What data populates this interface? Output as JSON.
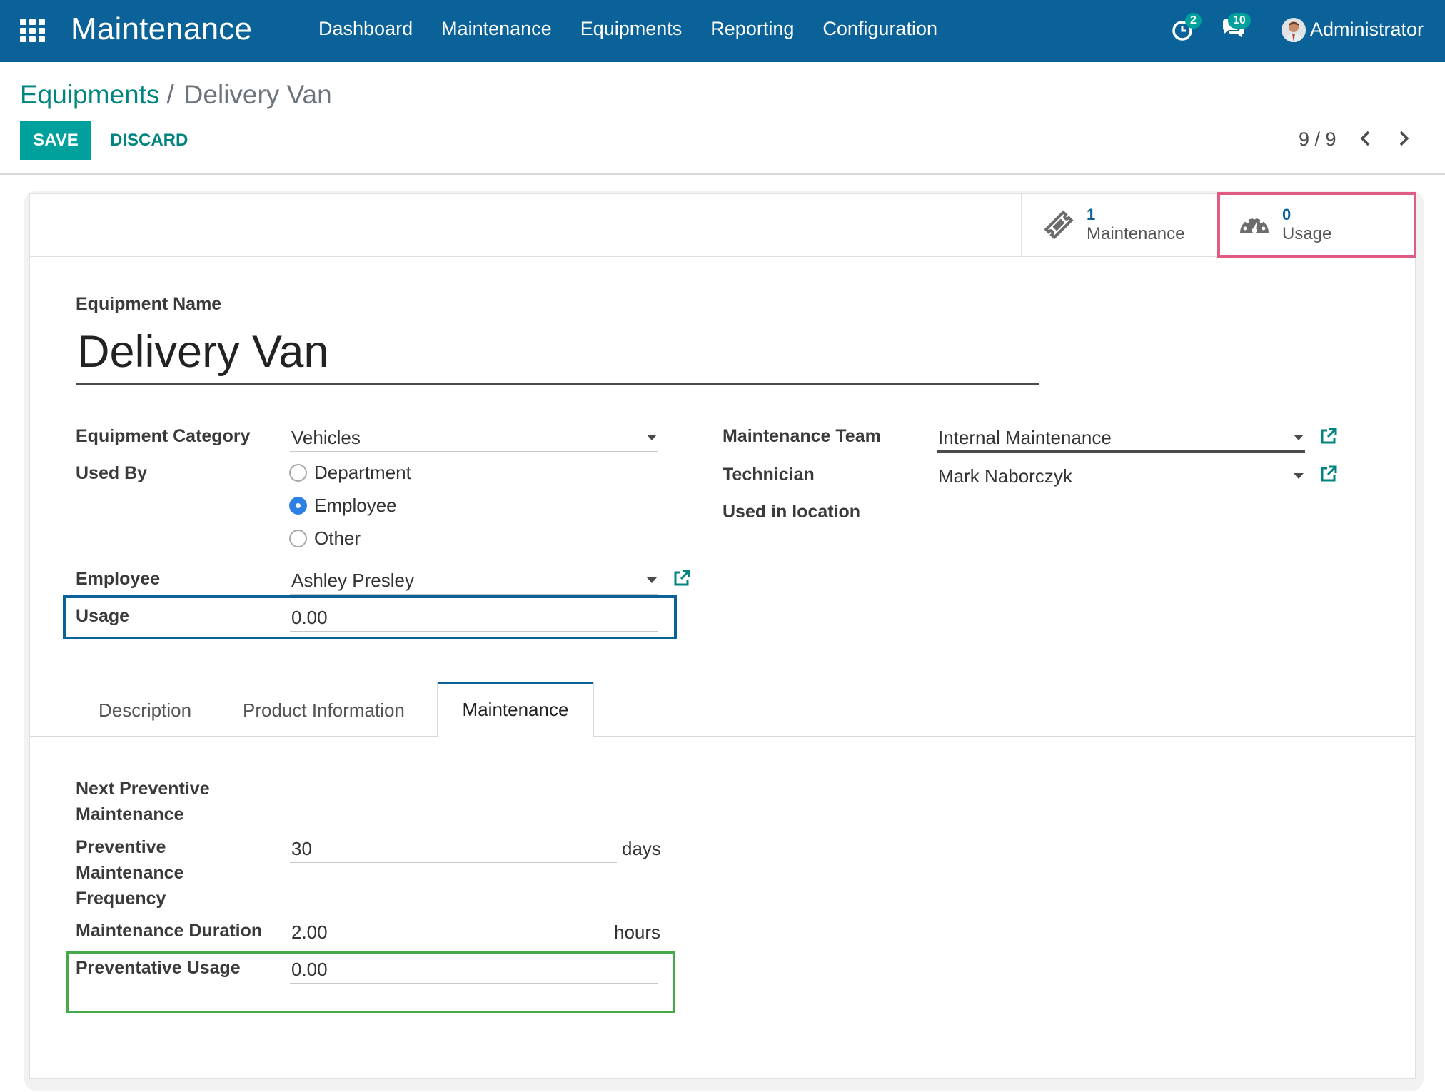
{
  "navbar": {
    "app_title": "Maintenance",
    "menu": [
      "Dashboard",
      "Maintenance",
      "Equipments",
      "Reporting",
      "Configuration"
    ],
    "activity_count": "2",
    "message_count": "10",
    "user_name": "Administrator"
  },
  "breadcrumb": {
    "parent": "Equipments",
    "separator": "/",
    "current": "Delivery Van"
  },
  "toolbar": {
    "save_label": "SAVE",
    "discard_label": "DISCARD",
    "pager": "9 / 9"
  },
  "stat_buttons": {
    "maintenance": {
      "value": "1",
      "label": "Maintenance"
    },
    "usage": {
      "value": "0",
      "label": "Usage"
    }
  },
  "form": {
    "equipment_name_label": "Equipment Name",
    "equipment_name": "Delivery Van",
    "category_label": "Equipment Category",
    "category_value": "Vehicles",
    "used_by_label": "Used By",
    "used_by_options": [
      "Department",
      "Employee",
      "Other"
    ],
    "used_by_selected": "Employee",
    "employee_label": "Employee",
    "employee_value": "Ashley Presley",
    "usage_label": "Usage",
    "usage_value": "0.00",
    "team_label": "Maintenance Team",
    "team_value": "Internal Maintenance",
    "technician_label": "Technician",
    "technician_value": "Mark Naborczyk",
    "location_label": "Used in location",
    "location_value": ""
  },
  "tabs": {
    "description": "Description",
    "product_info": "Product Information",
    "maintenance": "Maintenance"
  },
  "maintenance_tab": {
    "next_label_1": "Next Preventive",
    "next_label_2": "Maintenance",
    "freq_label_1": "Preventive",
    "freq_label_2": "Maintenance",
    "freq_label_3": "Frequency",
    "freq_value": "30",
    "freq_unit": "days",
    "duration_label": "Maintenance Duration",
    "duration_value": "2.00",
    "duration_unit": "hours",
    "prev_usage_label": "Preventative Usage",
    "prev_usage_value": "0.00"
  },
  "colors": {
    "navbar": "#0b6298",
    "primary_button": "#00a09d",
    "link": "#00847f",
    "highlight_pink": "#e05a82",
    "highlight_blue": "#0b6298",
    "highlight_green": "#46a84b"
  }
}
